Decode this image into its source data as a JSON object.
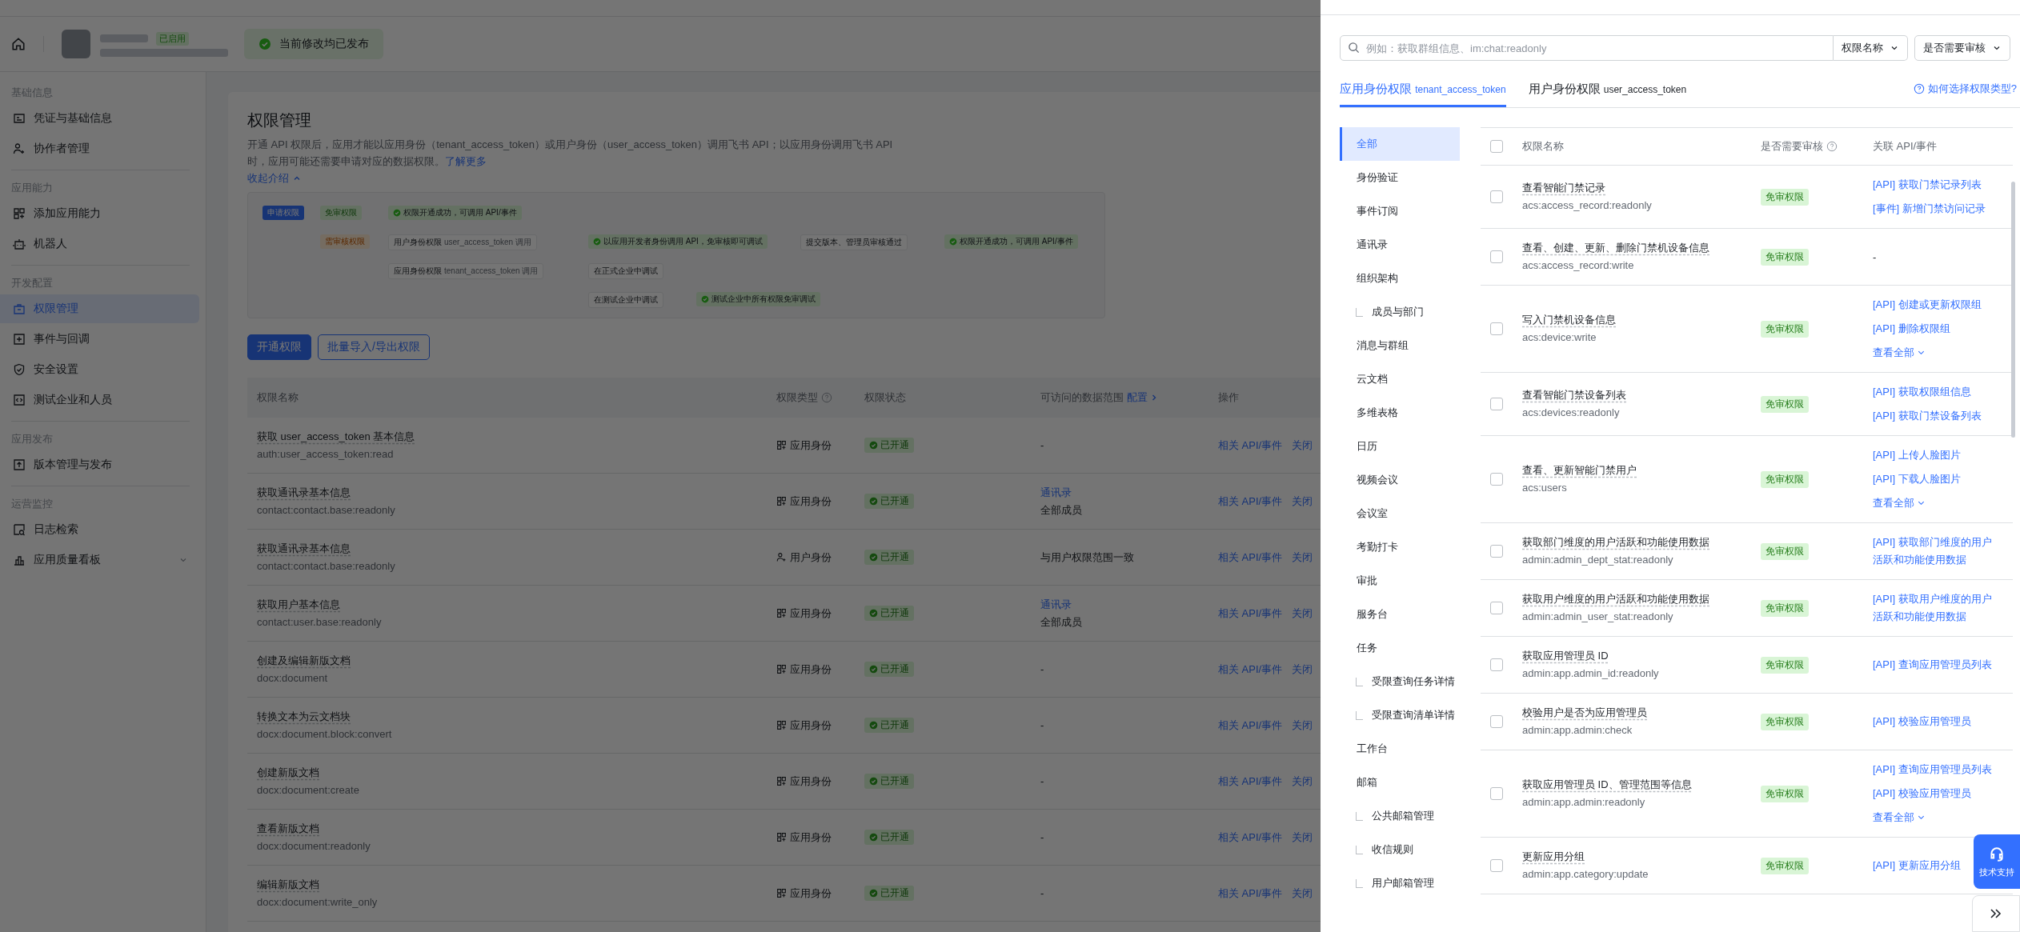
{
  "header": {
    "app_status": "已启用",
    "publish_status": "当前修改均已发布"
  },
  "sidebar": {
    "sections": [
      {
        "title": "基础信息",
        "items": [
          {
            "label": "凭证与基础信息",
            "kind": "card",
            "selected": false
          },
          {
            "label": "协作者管理",
            "kind": "user",
            "selected": false
          }
        ]
      },
      {
        "title": "应用能力",
        "items": [
          {
            "label": "添加应用能力",
            "kind": "grid",
            "selected": false
          },
          {
            "label": "机器人",
            "kind": "robot",
            "selected": false
          }
        ]
      },
      {
        "title": "开发配置",
        "items": [
          {
            "label": "权限管理",
            "kind": "bag",
            "selected": true
          },
          {
            "label": "事件与回调",
            "kind": "event",
            "selected": false
          },
          {
            "label": "安全设置",
            "kind": "shield",
            "selected": false
          },
          {
            "label": "测试企业和人员",
            "kind": "code",
            "selected": false
          }
        ]
      },
      {
        "title": "应用发布",
        "items": [
          {
            "label": "版本管理与发布",
            "kind": "upload",
            "selected": false
          }
        ]
      },
      {
        "title": "运营监控",
        "items": [
          {
            "label": "日志检索",
            "kind": "log",
            "selected": false
          },
          {
            "label": "应用质量看板",
            "kind": "chart",
            "selected": false,
            "expanded": false
          }
        ]
      }
    ]
  },
  "main": {
    "title": "权限管理",
    "description": "开通 API 权限后，应用才能以应用身份（tenant_access_token）或用户身份（user_access_token）调用飞书 API；以应用身份调用飞书 API 时，应用可能还需要申请对应的数据权限。",
    "learn_more": "了解更多",
    "collapse": "收起介绍",
    "flow": [
      {
        "kind": "start",
        "text": "申请权限"
      },
      {
        "kind": "free",
        "text": "免审权限"
      },
      {
        "kind": "success",
        "text": "权限开通成功，可调用 API/事件"
      },
      {
        "kind": "review",
        "text": "需审核权限"
      },
      {
        "kind": "step",
        "text": "用户身份权限",
        "note": "user_access_token 调用"
      },
      {
        "kind": "success",
        "text": "以应用开发者身份调用 API，免审核即可调试"
      },
      {
        "kind": "step",
        "text": "提交版本、管理员审核通过"
      },
      {
        "kind": "success",
        "text": "权限开通成功，可调用 API/事件"
      },
      {
        "kind": "step",
        "text": "应用身份权限",
        "note": "tenant_access_token 调用"
      },
      {
        "kind": "step",
        "text": "在正式企业中调试"
      },
      {
        "kind": "step",
        "text": "在测试企业中调试"
      },
      {
        "kind": "success",
        "text": "测试企业中所有权限免审调试"
      }
    ],
    "buttons": [
      {
        "label": "开通权限",
        "kind": "primary"
      },
      {
        "label": "批量导入/导出权限",
        "kind": "outline"
      }
    ],
    "table": {
      "columns": [
        "权限名称",
        "权限类型",
        "权限状态",
        "可访问的数据范围",
        "操作"
      ],
      "scope_config": "配置",
      "rows": [
        {
          "name": "获取 user_access_token 基本信息",
          "code": "auth:user_access_token:read",
          "type": "应用身份",
          "kind": "app",
          "status": "已开通",
          "scope": "-",
          "actions": [
            "相关 API/事件",
            "关闭"
          ]
        },
        {
          "name": "获取通讯录基本信息",
          "code": "contact:contact.base:readonly",
          "type": "应用身份",
          "kind": "app",
          "status": "已开通",
          "scope_link": "通讯录",
          "scope": "全部成员",
          "actions": [
            "相关 API/事件",
            "关闭"
          ]
        },
        {
          "name": "获取通讯录基本信息",
          "code": "contact:contact.base:readonly",
          "type": "用户身份",
          "kind": "user",
          "status": "已开通",
          "scope": "与用户权限范围一致",
          "actions": [
            "相关 API/事件",
            "关闭"
          ]
        },
        {
          "name": "获取用户基本信息",
          "code": "contact:user.base:readonly",
          "type": "应用身份",
          "kind": "app",
          "status": "已开通",
          "scope_link": "通讯录",
          "scope": "全部成员",
          "actions": [
            "相关 API/事件",
            "关闭"
          ]
        },
        {
          "name": "创建及编辑新版文档",
          "code": "docx:document",
          "type": "应用身份",
          "kind": "app",
          "status": "已开通",
          "scope": "-",
          "actions": [
            "相关 API/事件",
            "关闭"
          ]
        },
        {
          "name": "转换文本为云文档块",
          "code": "docx:document.block:convert",
          "type": "应用身份",
          "kind": "app",
          "status": "已开通",
          "scope": "-",
          "actions": [
            "相关 API/事件",
            "关闭"
          ]
        },
        {
          "name": "创建新版文档",
          "code": "docx:document:create",
          "type": "应用身份",
          "kind": "app",
          "status": "已开通",
          "scope": "-",
          "actions": [
            "相关 API/事件",
            "关闭"
          ]
        },
        {
          "name": "查看新版文档",
          "code": "docx:document:readonly",
          "type": "应用身份",
          "kind": "app",
          "status": "已开通",
          "scope": "-",
          "actions": [
            "相关 API/事件",
            "关闭"
          ]
        },
        {
          "name": "编辑新版文档",
          "code": "docx:document:write_only",
          "type": "应用身份",
          "kind": "app",
          "status": "已开通",
          "scope": "-",
          "actions": [
            "相关 API/事件",
            "关闭"
          ]
        }
      ]
    }
  },
  "drawer": {
    "search": {
      "placeholder": "例如：获取群组信息、im:chat:readonly"
    },
    "filters": [
      "权限名称",
      "是否需要审核"
    ],
    "tabs": [
      {
        "label": "应用身份权限",
        "token": "tenant_access_token",
        "selected": true
      },
      {
        "label": "用户身份权限",
        "token": "user_access_token",
        "selected": false
      }
    ],
    "help_link": "如何选择权限类型?",
    "categories": [
      {
        "label": "全部",
        "selected": true
      },
      {
        "label": "身份验证",
        "selected": false
      },
      {
        "label": "事件订阅",
        "selected": false
      },
      {
        "label": "通讯录",
        "selected": false
      },
      {
        "label": "组织架构",
        "selected": false,
        "children": [
          {
            "label": "成员与部门",
            "selected": false
          }
        ]
      },
      {
        "label": "消息与群组",
        "selected": false
      },
      {
        "label": "云文档",
        "selected": false
      },
      {
        "label": "多维表格",
        "selected": false
      },
      {
        "label": "日历",
        "selected": false
      },
      {
        "label": "视频会议",
        "selected": false
      },
      {
        "label": "会议室",
        "selected": false
      },
      {
        "label": "考勤打卡",
        "selected": false
      },
      {
        "label": "审批",
        "selected": false
      },
      {
        "label": "服务台",
        "selected": false
      },
      {
        "label": "任务",
        "selected": false,
        "children": [
          {
            "label": "受限查询任务详情",
            "selected": false
          },
          {
            "label": "受限查询清单详情",
            "selected": false
          }
        ]
      },
      {
        "label": "工作台",
        "selected": false
      },
      {
        "label": "邮箱",
        "selected": false,
        "children": [
          {
            "label": "公共邮箱管理",
            "selected": false
          },
          {
            "label": "收信规则",
            "selected": false
          },
          {
            "label": "用户邮箱管理",
            "selected": false
          }
        ]
      }
    ],
    "table": {
      "header_checked": false,
      "columns": [
        "权限名称",
        "是否需要审核",
        "关联 API/事件"
      ],
      "rows": [
        {
          "checked": false,
          "name": "查看智能门禁记录",
          "code": "acs:access_record:readonly",
          "review": "免审权限",
          "links": [
            "[API] 获取门禁记录列表",
            "[事件] 新增门禁访问记录"
          ]
        },
        {
          "checked": false,
          "name": "查看、创建、更新、删除门禁机设备信息",
          "code": "acs:access_record:write",
          "review": "免审权限",
          "links": [],
          "empty": "-"
        },
        {
          "checked": false,
          "name": "写入门禁机设备信息",
          "code": "acs:device:write",
          "review": "免审权限",
          "links": [
            "[API] 创建或更新权限组",
            "[API] 删除权限组"
          ],
          "more": "查看全部"
        },
        {
          "checked": false,
          "name": "查看智能门禁设备列表",
          "code": "acs:devices:readonly",
          "review": "免审权限",
          "links": [
            "[API] 获取权限组信息",
            "[API] 获取门禁设备列表"
          ]
        },
        {
          "checked": false,
          "name": "查看、更新智能门禁用户",
          "code": "acs:users",
          "review": "免审权限",
          "links": [
            "[API] 上传人脸图片",
            "[API] 下载人脸图片"
          ],
          "more": "查看全部"
        },
        {
          "checked": false,
          "name": "获取部门维度的用户活跃和功能使用数据",
          "code": "admin:admin_dept_stat:readonly",
          "review": "免审权限",
          "links": [
            "[API] 获取部门维度的用户活跃和功能使用数据"
          ]
        },
        {
          "checked": false,
          "name": "获取用户维度的用户活跃和功能使用数据",
          "code": "admin:admin_user_stat:readonly",
          "review": "免审权限",
          "links": [
            "[API] 获取用户维度的用户活跃和功能使用数据"
          ]
        },
        {
          "checked": false,
          "name": "获取应用管理员 ID",
          "code": "admin:app.admin_id:readonly",
          "review": "免审权限",
          "links": [
            "[API] 查询应用管理员列表"
          ]
        },
        {
          "checked": false,
          "name": "校验用户是否为应用管理员",
          "code": "admin:app.admin:check",
          "review": "免审权限",
          "links": [
            "[API] 校验应用管理员"
          ]
        },
        {
          "checked": false,
          "name": "获取应用管理员 ID、管理范围等信息",
          "code": "admin:app.admin:readonly",
          "review": "免审权限",
          "links": [
            "[API] 查询应用管理员列表",
            "[API] 校验应用管理员"
          ],
          "more": "查看全部"
        },
        {
          "checked": false,
          "name": "更新应用分组",
          "code": "admin:app.category:update",
          "review": "免审权限",
          "links": [
            "[API] 更新应用分组"
          ]
        }
      ]
    },
    "support_button": "技术支持"
  }
}
